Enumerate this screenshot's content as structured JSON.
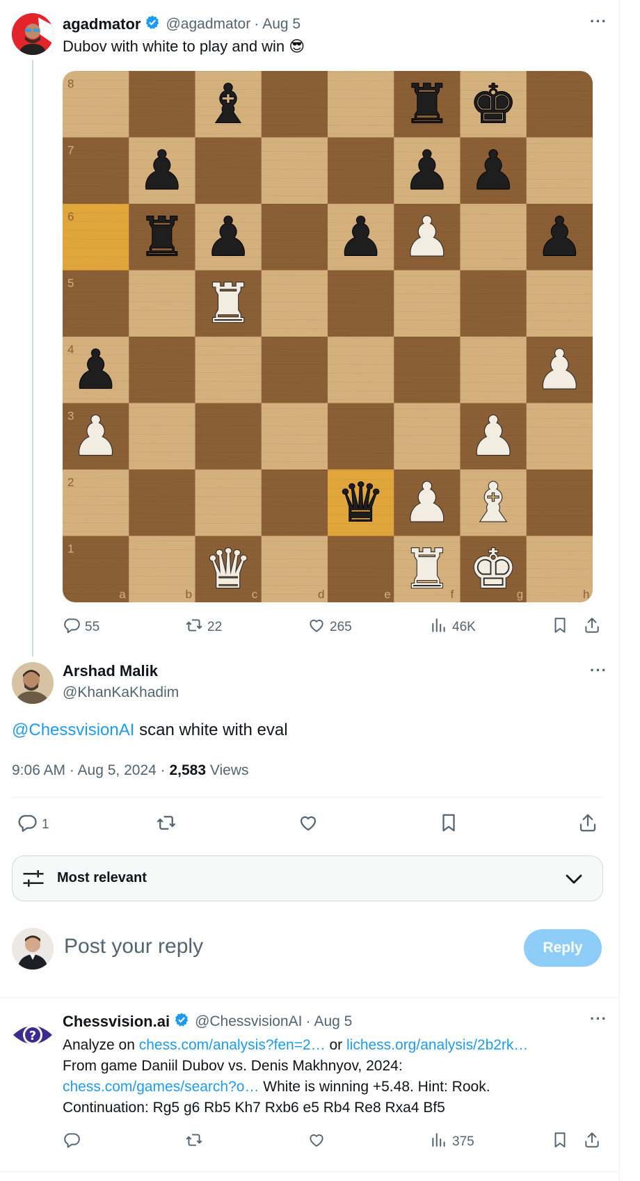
{
  "colors": {
    "link": "#1d9bf0",
    "muted": "#536471",
    "text": "#0f1419",
    "verified": "#1d9bf0",
    "light_square": "#d4b07c",
    "dark_square": "#8b5f36",
    "highlight_square": "#e0a63c",
    "reply_button": "#8ecdf7"
  },
  "tweet1": {
    "display_name": "agadmator",
    "handle": "@agadmator",
    "date": "Aug 5",
    "separator": "·",
    "text": "Dubov with white to play and win",
    "emoji": "😎",
    "more": "···",
    "stats": {
      "replies": "55",
      "reposts": "22",
      "likes": "265",
      "views": "46K"
    }
  },
  "board": {
    "ranks": [
      "8",
      "7",
      "6",
      "5",
      "4",
      "3",
      "2",
      "1"
    ],
    "files": [
      "a",
      "b",
      "c",
      "d",
      "e",
      "f",
      "g",
      "h"
    ],
    "highlights": [
      "a6",
      "e2"
    ],
    "pieces": [
      {
        "square": "c8",
        "glyph": "♝",
        "color": "black"
      },
      {
        "square": "f8",
        "glyph": "♜",
        "color": "black"
      },
      {
        "square": "g8",
        "glyph": "♚",
        "color": "black"
      },
      {
        "square": "b7",
        "glyph": "♟",
        "color": "black"
      },
      {
        "square": "f7",
        "glyph": "♟",
        "color": "black"
      },
      {
        "square": "g7",
        "glyph": "♟",
        "color": "black"
      },
      {
        "square": "b6",
        "glyph": "♜",
        "color": "black"
      },
      {
        "square": "c6",
        "glyph": "♟",
        "color": "black"
      },
      {
        "square": "e6",
        "glyph": "♟",
        "color": "black"
      },
      {
        "square": "f6",
        "glyph": "♟",
        "color": "white"
      },
      {
        "square": "h6",
        "glyph": "♟",
        "color": "black"
      },
      {
        "square": "c5",
        "glyph": "♜",
        "color": "white"
      },
      {
        "square": "a4",
        "glyph": "♟",
        "color": "black"
      },
      {
        "square": "h4",
        "glyph": "♟",
        "color": "white"
      },
      {
        "square": "a3",
        "glyph": "♟",
        "color": "white"
      },
      {
        "square": "g3",
        "glyph": "♟",
        "color": "white"
      },
      {
        "square": "e2",
        "glyph": "♛",
        "color": "black"
      },
      {
        "square": "f2",
        "glyph": "♟",
        "color": "white"
      },
      {
        "square": "g2",
        "glyph": "♝",
        "color": "white"
      },
      {
        "square": "c1",
        "glyph": "♛",
        "color": "white"
      },
      {
        "square": "f1",
        "glyph": "♜",
        "color": "white"
      },
      {
        "square": "g1",
        "glyph": "♚",
        "color": "white"
      }
    ]
  },
  "focus": {
    "display_name": "Arshad Malik",
    "handle": "@KhanKaKhadim",
    "mention": "@ChessvisionAI",
    "text": " scan white with eval",
    "time": "9:06 AM · Aug 5, 2024 · ",
    "views_count": "2,583",
    "views_label": " Views",
    "more": "···",
    "stats": {
      "replies": "1"
    }
  },
  "sort": {
    "label": "Most relevant"
  },
  "composer": {
    "placeholder": "Post your reply",
    "button": "Reply"
  },
  "reply": {
    "display_name": "Chessvision.ai",
    "handle": "@ChessvisionAI",
    "date": "Aug 5",
    "separator": "·",
    "more": "···",
    "line1_prefix": "Analyze on ",
    "link1": "chess.com/analysis?fen=2…",
    "line1_mid": " or ",
    "link2": "lichess.org/analysis/2b2rk…",
    "line2": "From game Daniil Dubov vs. Denis Makhnyov, 2024:",
    "link3": "chess.com/games/search?o…",
    "line3_suffix": " White is winning +5.48. Hint: Rook.",
    "line4": "Continuation: Rg5 g6 Rb5 Kh7 Rxb6 e5 Rb4 Re8 Rxa4 Bf5",
    "stats": {
      "views": "375"
    }
  }
}
